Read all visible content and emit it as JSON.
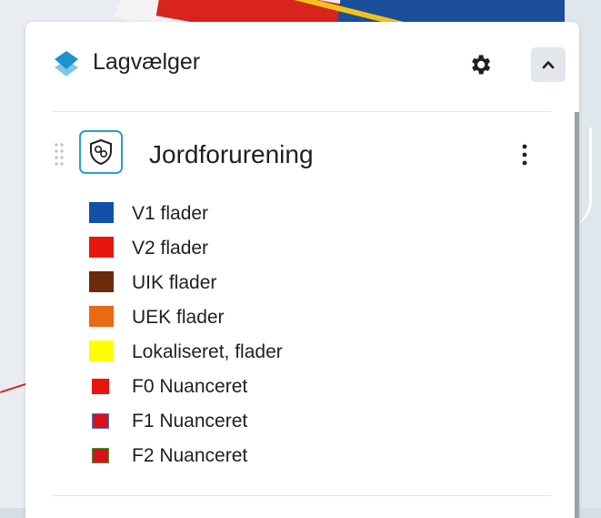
{
  "panel": {
    "title": "Lagvælger",
    "settings_icon": "gear-icon",
    "collapse_icon": "chevron-up-icon"
  },
  "layer": {
    "name": "Jordforurening",
    "icon": "soil-contamination-icon",
    "menu_icon": "kebab-menu-icon"
  },
  "legend": [
    {
      "label": "V1 flader",
      "color": "#1450a8",
      "swatch": "big"
    },
    {
      "label": "V2 flader",
      "color": "#e8170d",
      "swatch": "big"
    },
    {
      "label": "UIK flader",
      "color": "#6e2a0c",
      "swatch": "big"
    },
    {
      "label": "UEK flader",
      "color": "#ea6a12",
      "swatch": "big"
    },
    {
      "label": "Lokaliseret, flader",
      "color": "#ffff00",
      "swatch": "big"
    },
    {
      "label": "F0 Nuanceret",
      "color": "#e8170d",
      "border": "#e8170d",
      "swatch": "small"
    },
    {
      "label": "F1 Nuanceret",
      "color": "#d8121b",
      "border": "#4a7ad0",
      "swatch": "small"
    },
    {
      "label": "F2 Nuanceret",
      "color": "#d8121b",
      "border": "#3e9b3e",
      "swatch": "small"
    }
  ],
  "colors": {
    "accent": "#2a9fd0",
    "text": "#1f1f1f"
  }
}
